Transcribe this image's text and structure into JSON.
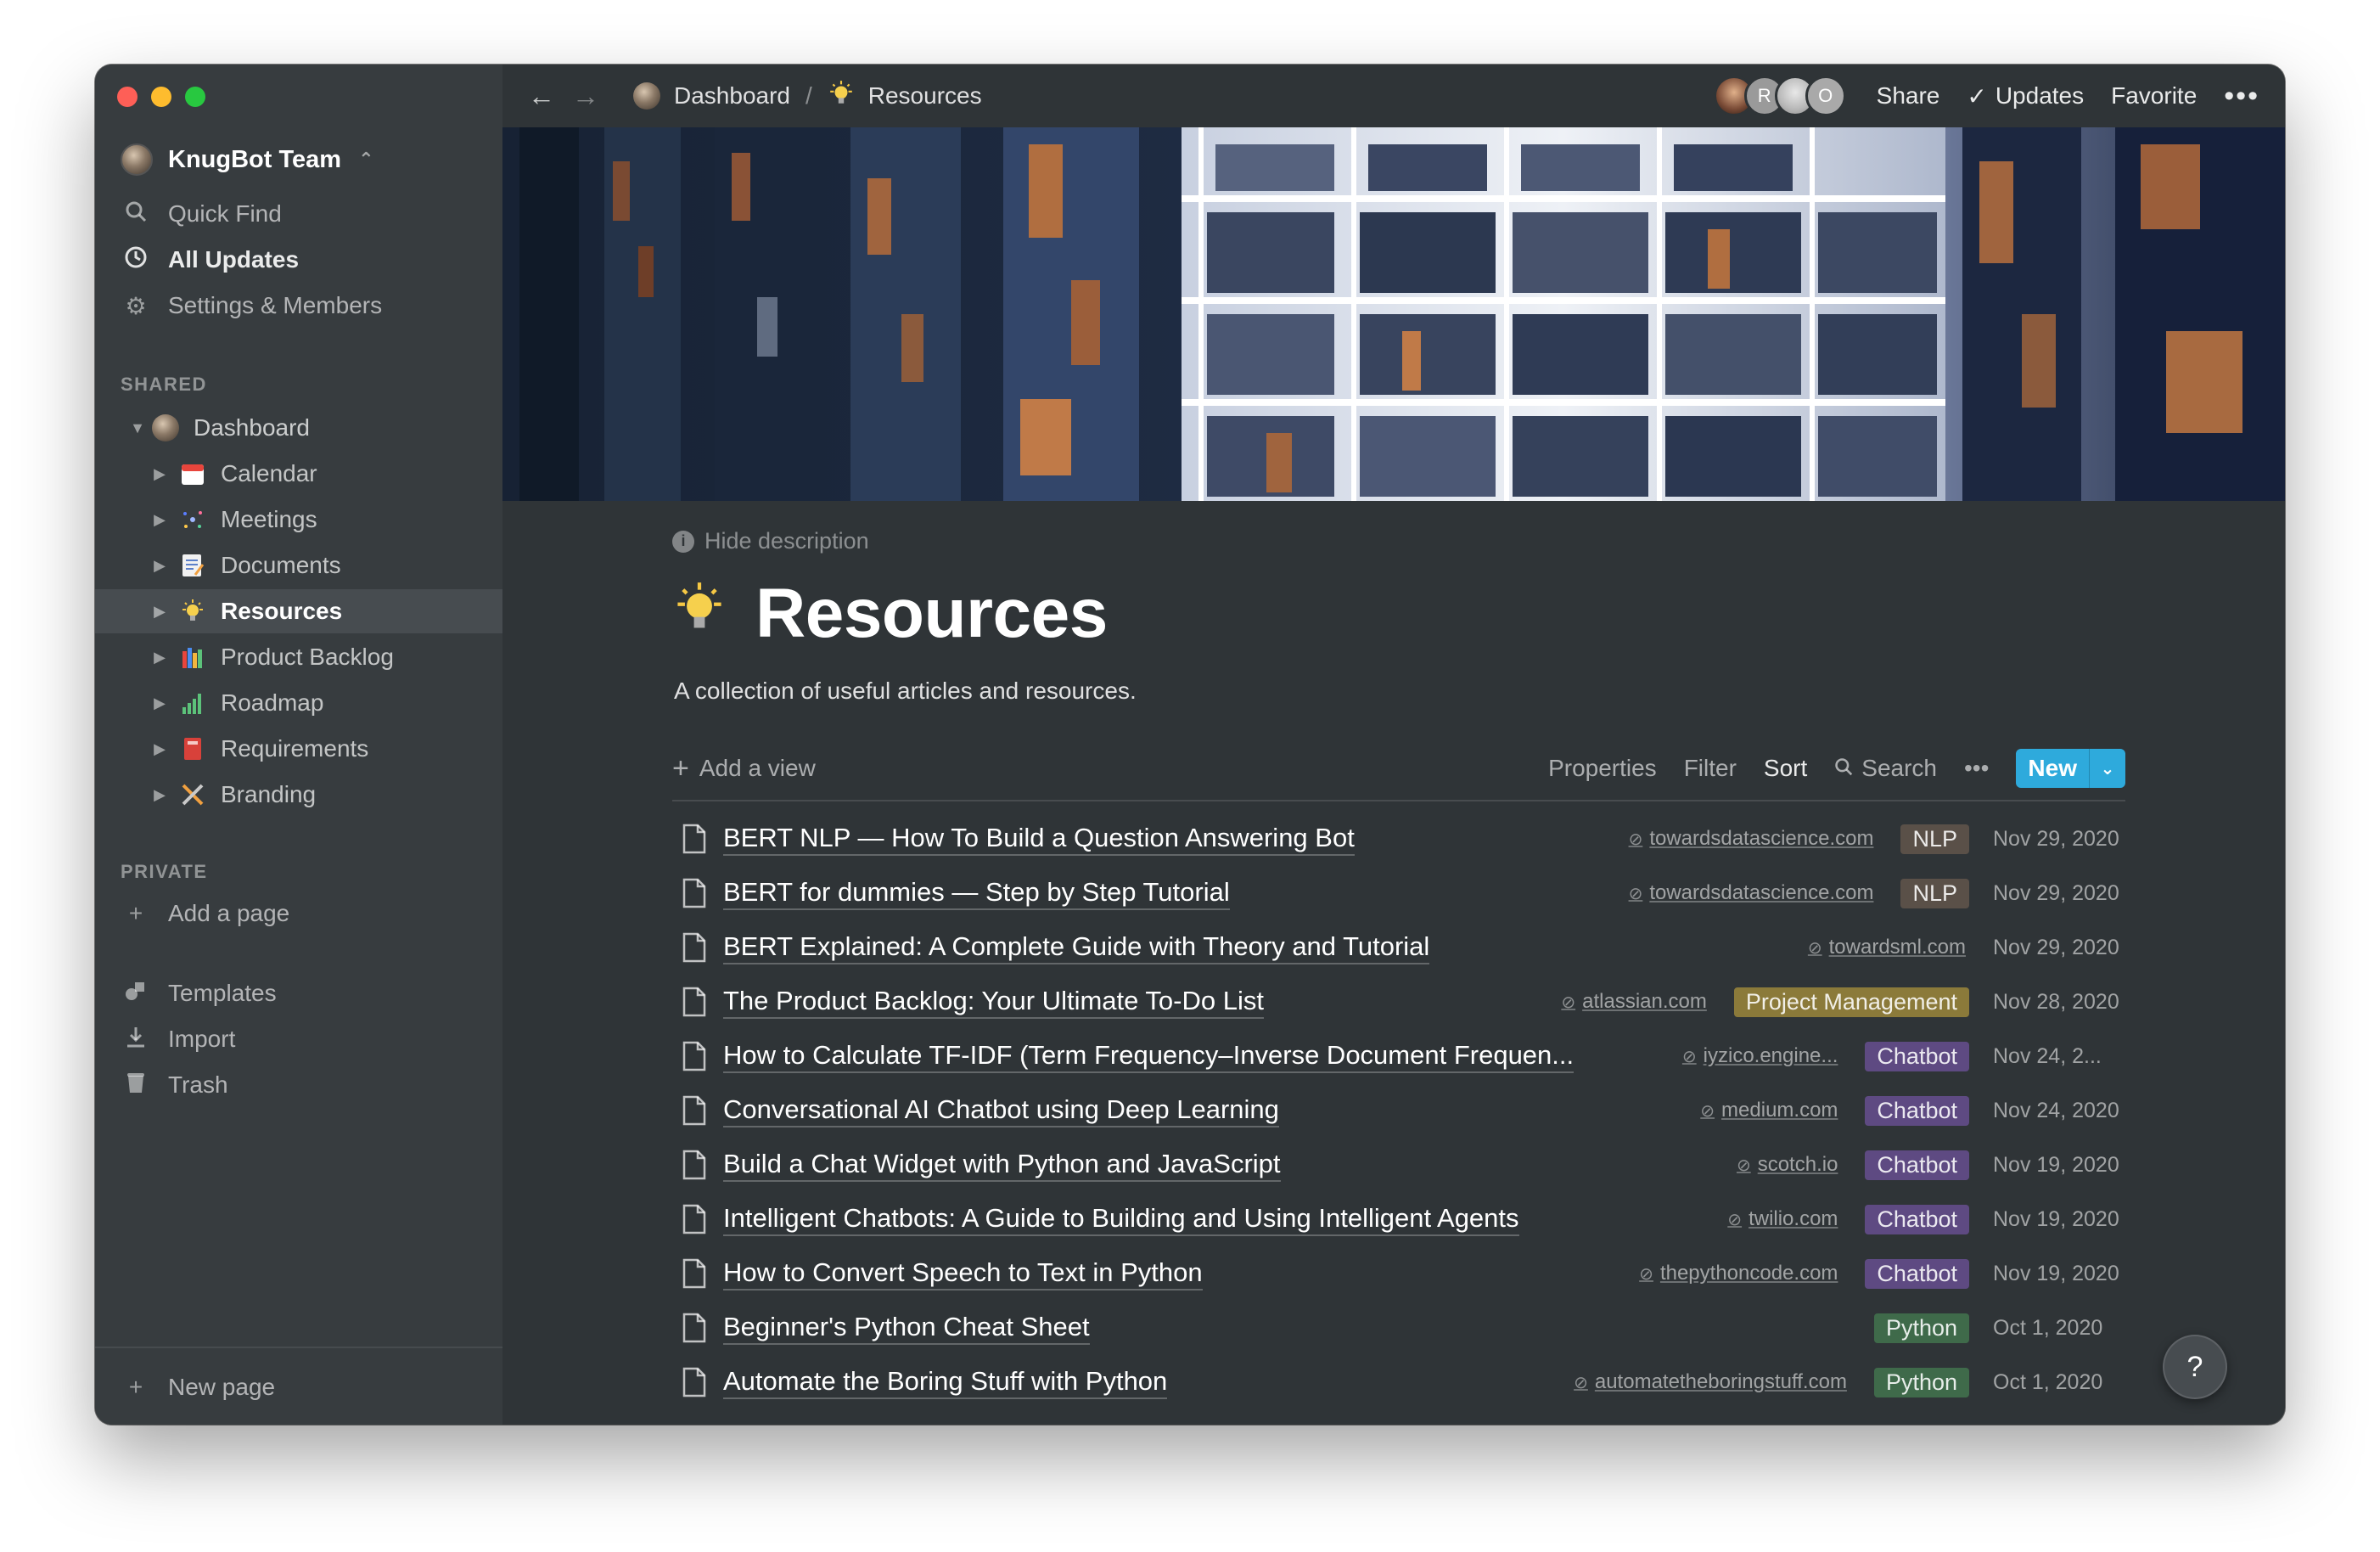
{
  "colors": {
    "window_bg": "#2f3437",
    "sidebar_bg": "#373c3f",
    "selected_bg": "#474c50",
    "accent_blue": "#2eaadc",
    "tag_nlp": "#5a5048",
    "tag_project_management": "#8b7a3a",
    "tag_chatbot": "#5e4a82",
    "tag_python": "#3f6a4a"
  },
  "sidebar": {
    "workspace": "KnugBot Team",
    "top_items": [
      {
        "label": "Quick Find",
        "icon": "search-icon"
      },
      {
        "label": "All Updates",
        "icon": "clock-icon"
      },
      {
        "label": "Settings & Members",
        "icon": "gear-icon"
      }
    ],
    "shared_label": "SHARED",
    "root_page": "Dashboard",
    "pages": [
      {
        "label": "Calendar",
        "icon": "calendar-icon"
      },
      {
        "label": "Meetings",
        "icon": "sparkle-icon"
      },
      {
        "label": "Documents",
        "icon": "memo-icon"
      },
      {
        "label": "Resources",
        "icon": "lightbulb-icon"
      },
      {
        "label": "Product Backlog",
        "icon": "books-icon"
      },
      {
        "label": "Roadmap",
        "icon": "bar-chart-icon"
      },
      {
        "label": "Requirements",
        "icon": "red-book-icon"
      },
      {
        "label": "Branding",
        "icon": "tools-icon"
      }
    ],
    "private_label": "PRIVATE",
    "add_page": "Add a page",
    "bottom_items": [
      {
        "label": "Templates",
        "icon": "shapes-icon"
      },
      {
        "label": "Import",
        "icon": "download-icon"
      },
      {
        "label": "Trash",
        "icon": "trash-icon"
      }
    ],
    "new_page": "New page"
  },
  "topbar": {
    "breadcrumbs": [
      "Dashboard",
      "Resources"
    ],
    "avatars": [
      "",
      "R",
      "",
      "O"
    ],
    "share": "Share",
    "updates": "Updates",
    "favorite": "Favorite",
    "more": "•••"
  },
  "page": {
    "hide_description": "Hide description",
    "title": "Resources",
    "description": "A collection of useful articles and resources.",
    "emoji": "💡"
  },
  "toolbar": {
    "add_view": "Add a view",
    "properties": "Properties",
    "filter": "Filter",
    "sort": "Sort",
    "search": "Search",
    "more": "•••",
    "new": "New"
  },
  "rows": [
    {
      "title": "BERT NLP — How To Build a Question Answering Bot",
      "url": "towardsdatascience.com",
      "tag": "NLP",
      "tag_color": "#5a5048",
      "date": "Nov 29, 2020"
    },
    {
      "title": "BERT for dummies — Step by Step Tutorial",
      "url": "towardsdatascience.com",
      "tag": "NLP",
      "tag_color": "#5a5048",
      "date": "Nov 29, 2020"
    },
    {
      "title": "BERT Explained: A Complete Guide with Theory and Tutorial",
      "url": "towardsml.com",
      "tag": "",
      "tag_color": "",
      "date": "Nov 29, 2020"
    },
    {
      "title": "The Product Backlog: Your Ultimate To-Do List",
      "url": "atlassian.com",
      "tag": "Project Management",
      "tag_color": "#8b7a3a",
      "date": "Nov 28, 2020"
    },
    {
      "title": "How to Calculate TF-IDF (Term Frequency–Inverse Document Frequen...",
      "url": "iyzico.engine...",
      "tag": "Chatbot",
      "tag_color": "#5e4a82",
      "date": "Nov 24, 2..."
    },
    {
      "title": "Conversational AI Chatbot using Deep Learning",
      "url": "medium.com",
      "tag": "Chatbot",
      "tag_color": "#5e4a82",
      "date": "Nov 24, 2020"
    },
    {
      "title": "Build a Chat Widget with Python and JavaScript",
      "url": "scotch.io",
      "tag": "Chatbot",
      "tag_color": "#5e4a82",
      "date": "Nov 19, 2020"
    },
    {
      "title": "Intelligent Chatbots: A Guide to Building and Using Intelligent Agents",
      "url": "twilio.com",
      "tag": "Chatbot",
      "tag_color": "#5e4a82",
      "date": "Nov 19, 2020"
    },
    {
      "title": "How to Convert Speech to Text in Python",
      "url": "thepythoncode.com",
      "tag": "Chatbot",
      "tag_color": "#5e4a82",
      "date": "Nov 19, 2020"
    },
    {
      "title": "Beginner's Python Cheat Sheet",
      "url": "",
      "tag": "Python",
      "tag_color": "#3f6a4a",
      "date": "Oct 1, 2020"
    },
    {
      "title": "Automate the Boring Stuff with Python",
      "url": "automatetheboringstuff.com",
      "tag": "Python",
      "tag_color": "#3f6a4a",
      "date": "Oct 1, 2020"
    }
  ],
  "help": "?"
}
